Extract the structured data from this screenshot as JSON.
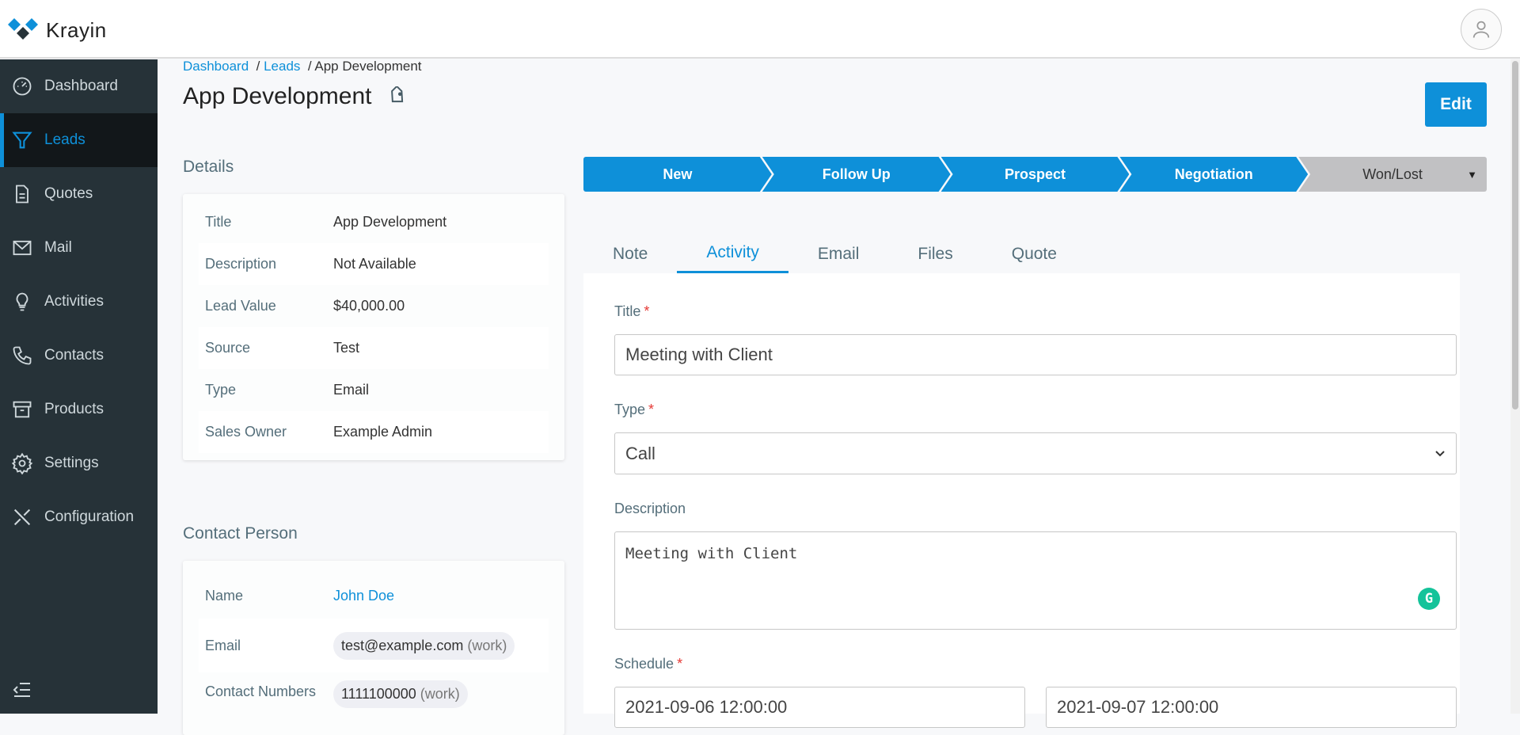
{
  "app": {
    "name": "Krayin"
  },
  "sidebar": {
    "items": [
      {
        "label": "Dashboard",
        "icon": "dashboard-icon"
      },
      {
        "label": "Leads",
        "icon": "funnel-icon",
        "active": true
      },
      {
        "label": "Quotes",
        "icon": "document-icon"
      },
      {
        "label": "Mail",
        "icon": "mail-icon"
      },
      {
        "label": "Activities",
        "icon": "lightbulb-icon"
      },
      {
        "label": "Contacts",
        "icon": "phone-icon"
      },
      {
        "label": "Products",
        "icon": "archive-icon"
      },
      {
        "label": "Settings",
        "icon": "gear-icon"
      },
      {
        "label": "Configuration",
        "icon": "tools-icon"
      }
    ]
  },
  "breadcrumb": {
    "items": [
      "Dashboard",
      "Leads"
    ],
    "current": "App Development"
  },
  "page": {
    "title": "App Development",
    "edit_label": "Edit"
  },
  "details": {
    "heading": "Details",
    "rows": [
      {
        "key": "Title",
        "value": "App Development"
      },
      {
        "key": "Description",
        "value": "Not Available"
      },
      {
        "key": "Lead Value",
        "value": "$40,000.00"
      },
      {
        "key": "Source",
        "value": "Test"
      },
      {
        "key": "Type",
        "value": "Email"
      },
      {
        "key": "Sales Owner",
        "value": "Example Admin"
      }
    ]
  },
  "contact": {
    "heading": "Contact Person",
    "name_label": "Name",
    "name": "John Doe",
    "email_label": "Email",
    "email": "test@example.com",
    "email_type": "(work)",
    "phone_label": "Contact Numbers",
    "phone": "1111100000",
    "phone_type": "(work)"
  },
  "pipeline": {
    "stages": [
      "New",
      "Follow Up",
      "Prospect",
      "Negotiation"
    ],
    "final": "Won/Lost",
    "colors": {
      "active": "#0e90d9",
      "final": "#c1c1c3"
    }
  },
  "tabs": {
    "items": [
      "Note",
      "Activity",
      "Email",
      "Files",
      "Quote"
    ],
    "active": "Activity"
  },
  "form": {
    "title_label": "Title",
    "title_value": "Meeting with Client",
    "type_label": "Type",
    "type_value": "Call",
    "description_label": "Description",
    "description_value": "Meeting with Client",
    "schedule_label": "Schedule",
    "schedule_from": "2021-09-06 12:00:00",
    "schedule_to": "2021-09-07 12:00:00",
    "required_mark": "*"
  }
}
